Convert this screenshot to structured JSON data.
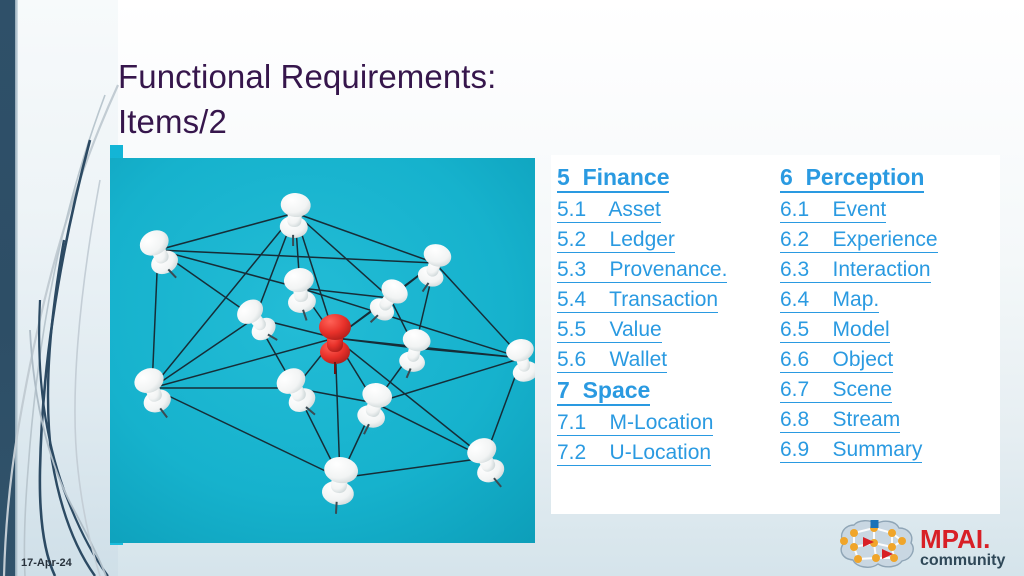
{
  "slide": {
    "title": "Functional Requirements:\nItems/2",
    "date": "17-Apr-24",
    "accent_cyan": "#19b9da",
    "accent_dark_navy": "#2f5069",
    "title_color": "#36164c",
    "link_color": "#2a9ae1",
    "card_background": "#ffffff"
  },
  "photo": {
    "alt": "network of white pushpins connected by black threads on a teal board with one red pushpin at the center",
    "background_color": "#19b4cf",
    "pin_color": "#ffffff",
    "highlight_pin_color": "#e8312a",
    "thread_color": "#1b2730"
  },
  "content": {
    "left_column": [
      {
        "number": "5",
        "label": "Finance",
        "type": "heading"
      },
      {
        "number": "5.1",
        "label": "Asset",
        "type": "item"
      },
      {
        "number": "5.2",
        "label": "Ledger",
        "type": "item"
      },
      {
        "number": "5.3",
        "label": "Provenance.",
        "type": "item"
      },
      {
        "number": "5.4",
        "label": "Transaction",
        "type": "item"
      },
      {
        "number": "5.5",
        "label": "Value",
        "type": "item"
      },
      {
        "number": "5.6",
        "label": "Wallet",
        "type": "item"
      },
      {
        "number": "7",
        "label": "Space",
        "type": "heading"
      },
      {
        "number": "7.1",
        "label": "M-Location",
        "type": "item"
      },
      {
        "number": "7.2",
        "label": "U-Location",
        "type": "item"
      }
    ],
    "right_column": [
      {
        "number": "6",
        "label": "Perception",
        "type": "heading"
      },
      {
        "number": "6.1",
        "label": "Event",
        "type": "item"
      },
      {
        "number": "6.2",
        "label": "Experience",
        "type": "item"
      },
      {
        "number": "6.3",
        "label": "Interaction",
        "type": "item"
      },
      {
        "number": "6.4",
        "label": "Map.",
        "type": "item"
      },
      {
        "number": "6.5",
        "label": "Model",
        "type": "item"
      },
      {
        "number": "6.6",
        "label": "Object",
        "type": "item"
      },
      {
        "number": "6.7",
        "label": "Scene",
        "type": "item"
      },
      {
        "number": "6.8",
        "label": "Stream",
        "type": "item"
      },
      {
        "number": "6.9",
        "label": "Summary",
        "type": "item"
      }
    ]
  },
  "logo": {
    "brand": "MPAI.",
    "tagline": "community",
    "brand_color": "#d81f26",
    "tagline_color": "#2f4858",
    "node_color": "#f0a52a",
    "accent_square_color": "#1b72b8",
    "accent_triangle_color": "#d81f26",
    "brain_fill": "#c9d7e2"
  }
}
